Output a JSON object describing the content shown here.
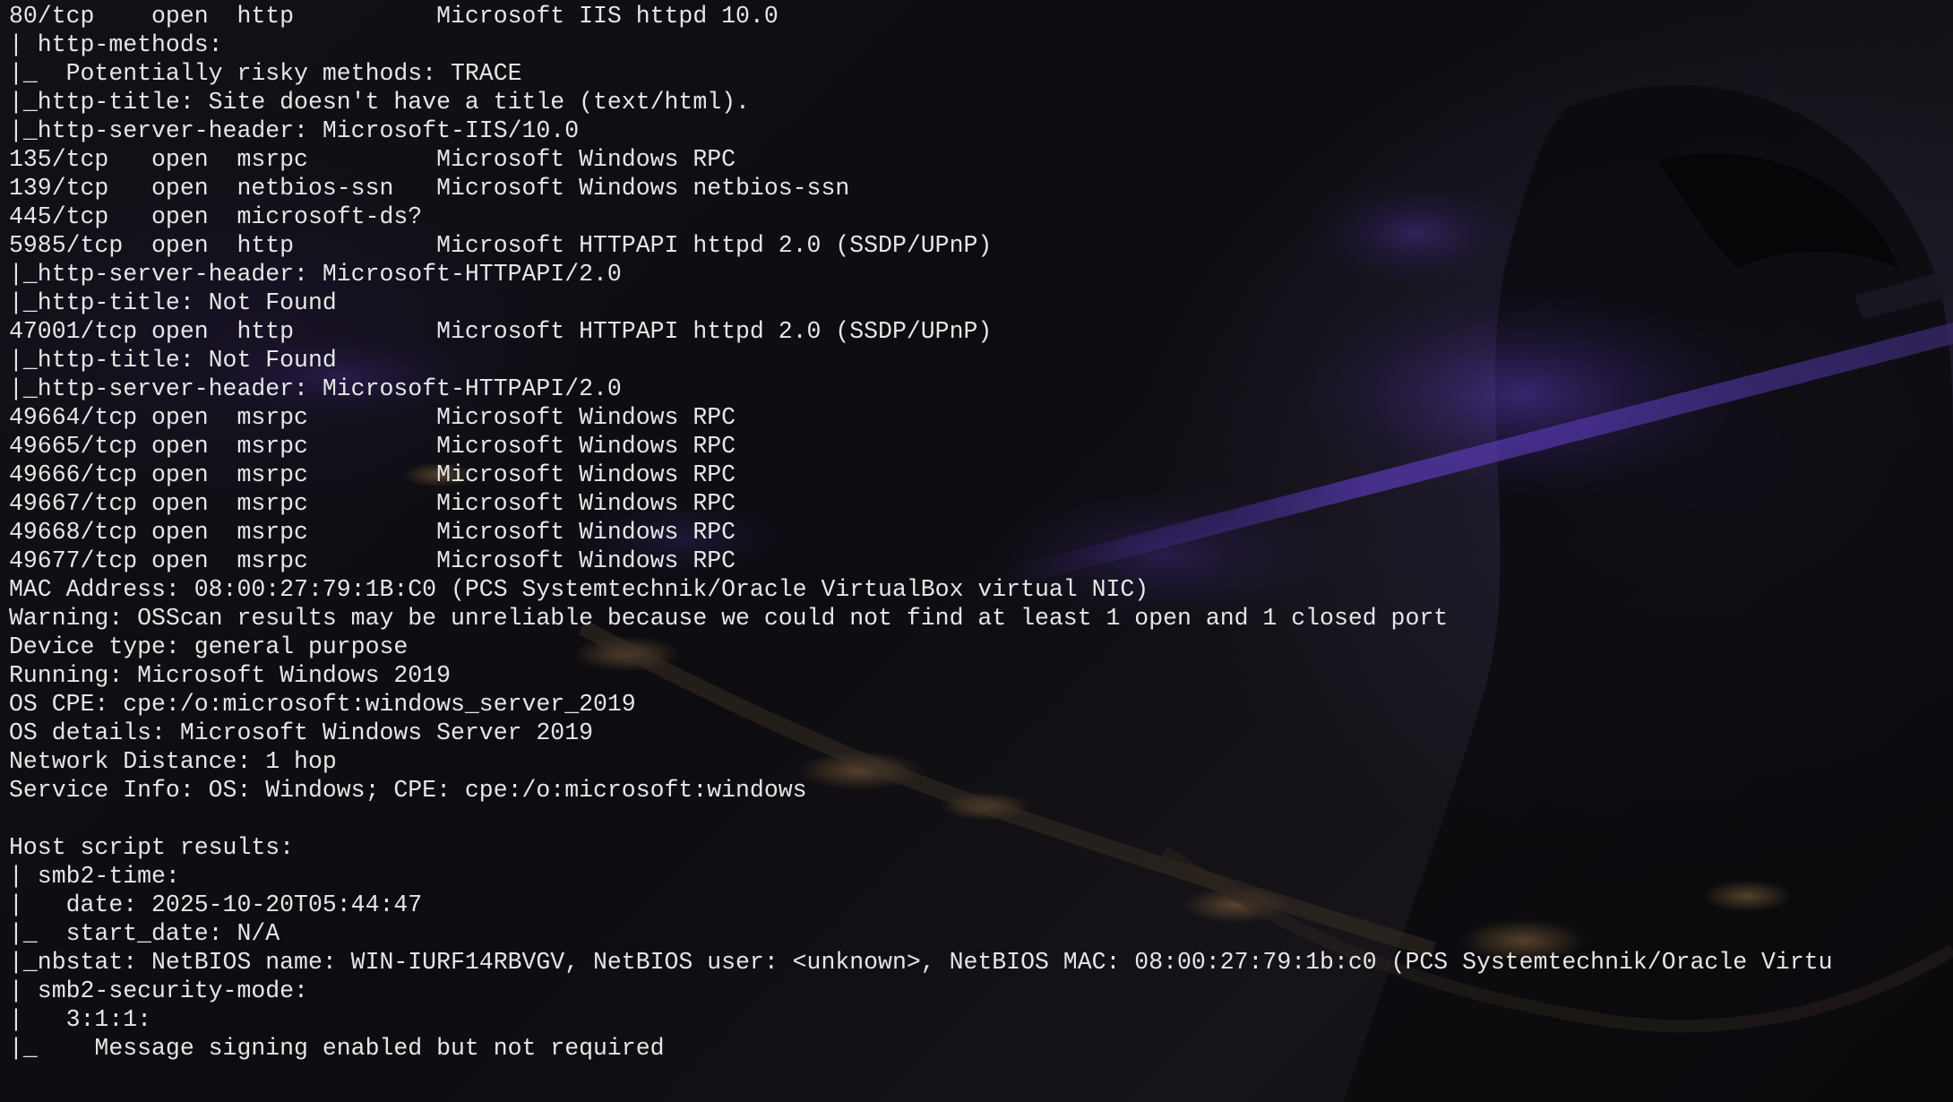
{
  "terminal": {
    "lines": [
      "80/tcp    open  http          Microsoft IIS httpd 10.0",
      "| http-methods:",
      "|_  Potentially risky methods: TRACE",
      "|_http-title: Site doesn't have a title (text/html).",
      "|_http-server-header: Microsoft-IIS/10.0",
      "135/tcp   open  msrpc         Microsoft Windows RPC",
      "139/tcp   open  netbios-ssn   Microsoft Windows netbios-ssn",
      "445/tcp   open  microsoft-ds?",
      "5985/tcp  open  http          Microsoft HTTPAPI httpd 2.0 (SSDP/UPnP)",
      "|_http-server-header: Microsoft-HTTPAPI/2.0",
      "|_http-title: Not Found",
      "47001/tcp open  http          Microsoft HTTPAPI httpd 2.0 (SSDP/UPnP)",
      "|_http-title: Not Found",
      "|_http-server-header: Microsoft-HTTPAPI/2.0",
      "49664/tcp open  msrpc         Microsoft Windows RPC",
      "49665/tcp open  msrpc         Microsoft Windows RPC",
      "49666/tcp open  msrpc         Microsoft Windows RPC",
      "49667/tcp open  msrpc         Microsoft Windows RPC",
      "49668/tcp open  msrpc         Microsoft Windows RPC",
      "49677/tcp open  msrpc         Microsoft Windows RPC",
      "MAC Address: 08:00:27:79:1B:C0 (PCS Systemtechnik/Oracle VirtualBox virtual NIC)",
      "Warning: OSScan results may be unreliable because we could not find at least 1 open and 1 closed port",
      "Device type: general purpose",
      "Running: Microsoft Windows 2019",
      "OS CPE: cpe:/o:microsoft:windows_server_2019",
      "OS details: Microsoft Windows Server 2019",
      "Network Distance: 1 hop",
      "Service Info: OS: Windows; CPE: cpe:/o:microsoft:windows",
      "",
      "Host script results:",
      "| smb2-time:",
      "|   date: 2025-10-20T05:44:47",
      "|_  start_date: N/A",
      "|_nbstat: NetBIOS name: WIN-IURF14RBVGV, NetBIOS user: <unknown>, NetBIOS MAC: 08:00:27:79:1b:c0 (PCS Systemtechnik/Oracle Virtu",
      "| smb2-security-mode:",
      "|   3:1:1:",
      "|_    Message signing enabled but not required"
    ]
  }
}
